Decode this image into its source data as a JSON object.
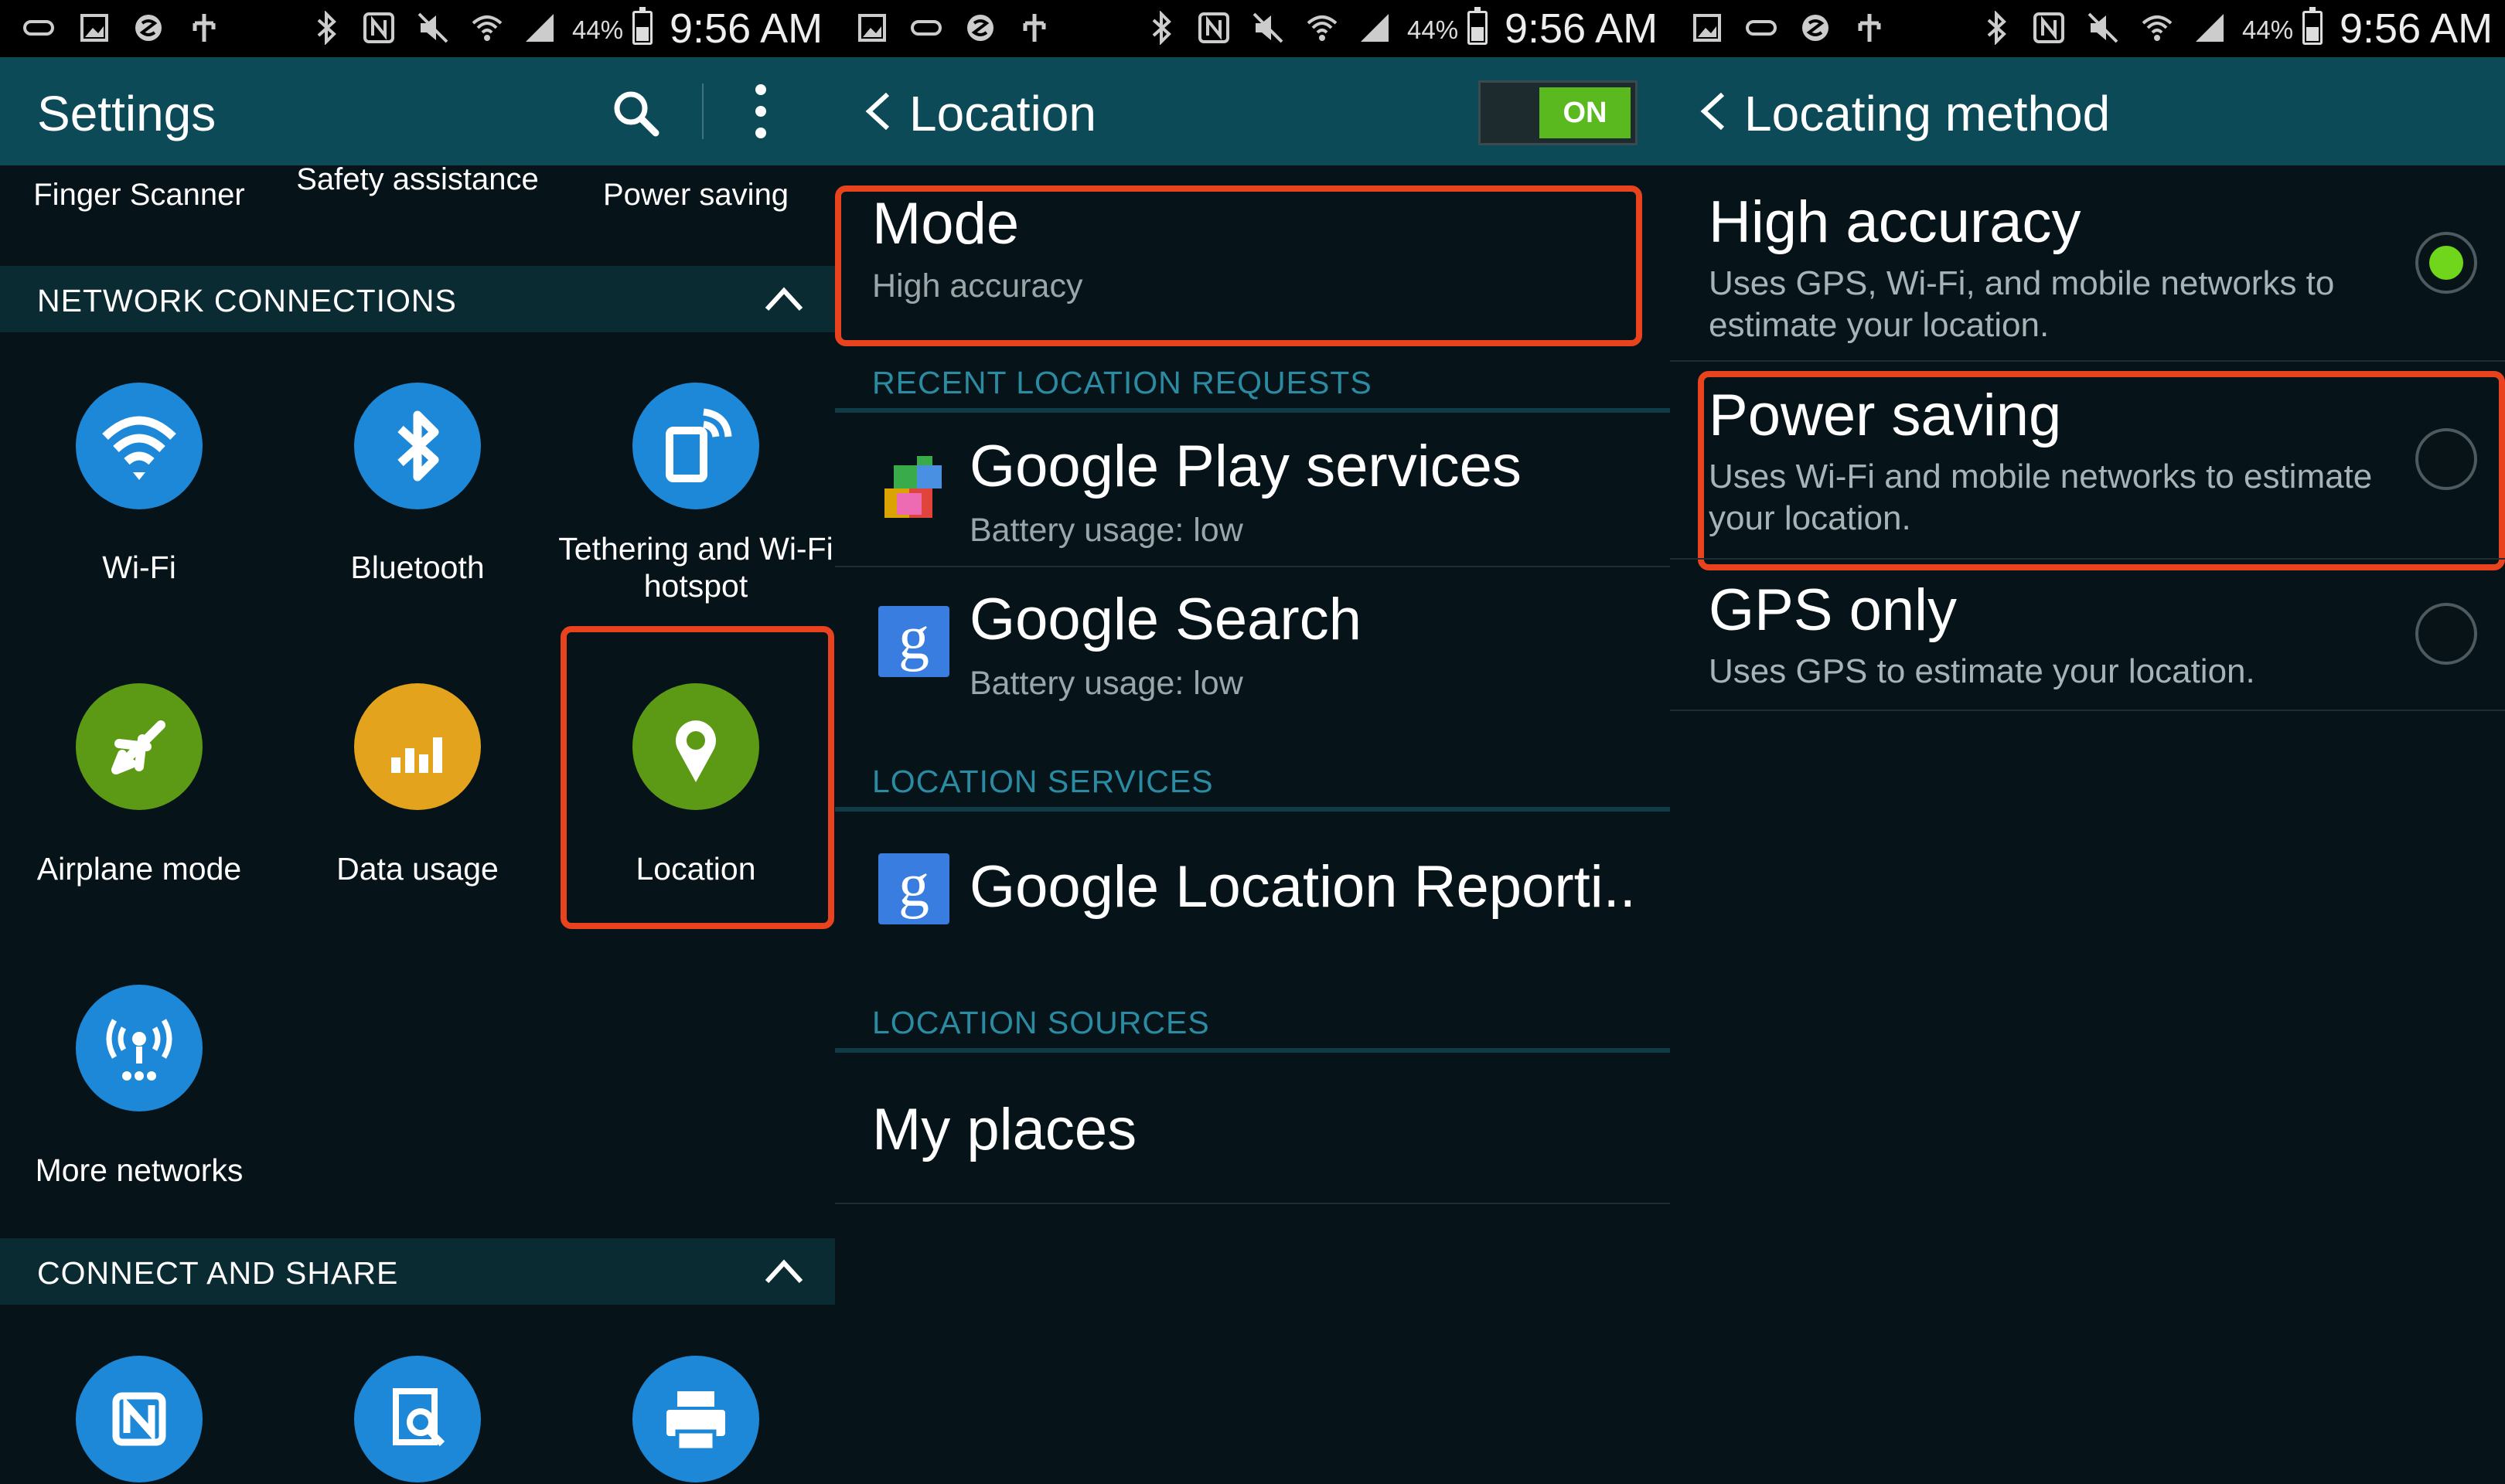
{
  "status_bar": {
    "battery_pct": "44%",
    "time": "9:56 AM"
  },
  "settings": {
    "title": "Settings",
    "top_row": [
      "Finger Scanner",
      "Safety assistance",
      "Power saving"
    ],
    "network_section": "NETWORK CONNECTIONS",
    "network_items": [
      {
        "label": "Wi-Fi",
        "icon": "wifi-icon",
        "color": "#1e88d8"
      },
      {
        "label": "Bluetooth",
        "icon": "bluetooth-icon",
        "color": "#1e88d8"
      },
      {
        "label": "Tethering and Wi-Fi hotspot",
        "icon": "hotspot-icon",
        "color": "#1e88d8"
      },
      {
        "label": "Airplane mode",
        "icon": "airplane-icon",
        "color": "#5c9a15"
      },
      {
        "label": "Data usage",
        "icon": "data-usage-icon",
        "color": "#e3a31c"
      },
      {
        "label": "Location",
        "icon": "location-pin-icon",
        "color": "#5c9a15"
      },
      {
        "label": "More networks",
        "icon": "more-networks-icon",
        "color": "#1e88d8"
      }
    ],
    "share_section": "CONNECT AND SHARE",
    "share_items": [
      {
        "icon": "nfc-icon",
        "color": "#1e88d8"
      },
      {
        "icon": "nearby-search-icon",
        "color": "#1e88d8"
      },
      {
        "icon": "printer-icon",
        "color": "#1e88d8"
      }
    ]
  },
  "location": {
    "title": "Location",
    "toggle_label": "ON",
    "mode_title": "Mode",
    "mode_value": "High accuracy",
    "recent_header": "RECENT LOCATION REQUESTS",
    "recent": [
      {
        "name": "Google Play services",
        "usage": "Battery usage: low",
        "icon": "google-play-services-icon"
      },
      {
        "name": "Google Search",
        "usage": "Battery usage: low",
        "icon": "google-search-icon"
      }
    ],
    "services_header": "LOCATION SERVICES",
    "services": [
      {
        "name": "Google Location Reporti..",
        "icon": "google-icon"
      }
    ],
    "sources_header": "LOCATION SOURCES",
    "sources": [
      {
        "name": "My places"
      }
    ]
  },
  "locating_method": {
    "title": "Locating method",
    "options": [
      {
        "title": "High accuracy",
        "desc": "Uses GPS, Wi-Fi, and mobile networks to estimate your location.",
        "selected": true
      },
      {
        "title": "Power saving",
        "desc": "Uses Wi-Fi and mobile networks to estimate your location.",
        "selected": false
      },
      {
        "title": "GPS only",
        "desc": "Uses GPS to estimate your location.",
        "selected": false
      }
    ]
  },
  "colors": {
    "action_bar": "#0c4a57",
    "highlight": "#e8421e",
    "accent_green": "#6fd61c",
    "category_text": "#2a8ba2"
  }
}
